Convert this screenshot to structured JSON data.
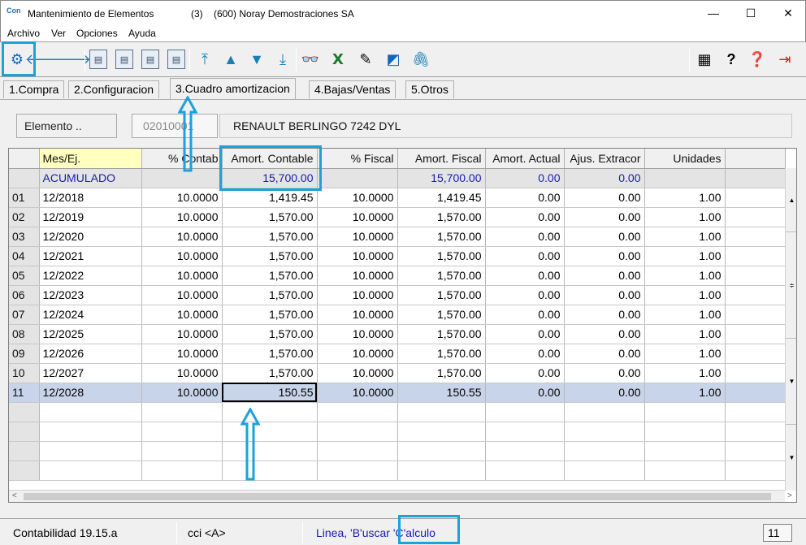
{
  "window": {
    "app_icon": "Con",
    "title": "Mantenimiento de Elementos",
    "count": "(3)",
    "company": "(600) Noray Demostraciones SA",
    "minimize": "—",
    "maximize": "☐",
    "close": "✕"
  },
  "menu": [
    {
      "label": "Archivo"
    },
    {
      "label": "Ver"
    },
    {
      "label": "Opciones"
    },
    {
      "label": "Ayuda"
    }
  ],
  "toolbar": {
    "icons": [
      "gear-icon",
      "arrow-left-icon",
      "arrow-right-icon",
      "doc-icon",
      "doc-icon",
      "doc-icon",
      "doc-icon",
      "first-icon",
      "up-icon",
      "down-icon",
      "last-icon",
      "binoculars-icon",
      "excel-icon",
      "tag-icon",
      "chart-icon",
      "paperclip-icon",
      "calculator-icon",
      "help-pointer-icon",
      "help-book-icon",
      "exit-icon"
    ],
    "excel_label": "X",
    "help_label": "?"
  },
  "tabs": [
    {
      "label": "1.Compra"
    },
    {
      "label": "2.Configuracion"
    },
    {
      "label": "3.Cuadro amortizacion"
    },
    {
      "label": "4.Bajas/Ventas"
    },
    {
      "label": "5.Otros"
    }
  ],
  "element": {
    "label": "Elemento ..",
    "code": "02010001",
    "description": "RENAULT BERLINGO 7242 DYL"
  },
  "grid": {
    "columns": [
      "",
      "Mes/Ej.",
      "% Contab",
      "Amort. Contable",
      "% Fiscal",
      "Amort. Fiscal",
      "Amort. Actual",
      "Ajus. Extracor",
      "Unidades",
      ""
    ],
    "acumulado": {
      "label": "ACUMULADO",
      "amort_contable": "15,700.00",
      "amort_fiscal": "15,700.00",
      "amort_actual": "0.00",
      "ajus": "0.00"
    },
    "rows": [
      {
        "n": "01",
        "mes": "12/2018",
        "pc": "10.0000",
        "ac": "1,419.45",
        "pf": "10.0000",
        "af": "1,419.45",
        "aa": "0.00",
        "ae": "0.00",
        "u": "1.00"
      },
      {
        "n": "02",
        "mes": "12/2019",
        "pc": "10.0000",
        "ac": "1,570.00",
        "pf": "10.0000",
        "af": "1,570.00",
        "aa": "0.00",
        "ae": "0.00",
        "u": "1.00"
      },
      {
        "n": "03",
        "mes": "12/2020",
        "pc": "10.0000",
        "ac": "1,570.00",
        "pf": "10.0000",
        "af": "1,570.00",
        "aa": "0.00",
        "ae": "0.00",
        "u": "1.00"
      },
      {
        "n": "04",
        "mes": "12/2021",
        "pc": "10.0000",
        "ac": "1,570.00",
        "pf": "10.0000",
        "af": "1,570.00",
        "aa": "0.00",
        "ae": "0.00",
        "u": "1.00"
      },
      {
        "n": "05",
        "mes": "12/2022",
        "pc": "10.0000",
        "ac": "1,570.00",
        "pf": "10.0000",
        "af": "1,570.00",
        "aa": "0.00",
        "ae": "0.00",
        "u": "1.00"
      },
      {
        "n": "06",
        "mes": "12/2023",
        "pc": "10.0000",
        "ac": "1,570.00",
        "pf": "10.0000",
        "af": "1,570.00",
        "aa": "0.00",
        "ae": "0.00",
        "u": "1.00"
      },
      {
        "n": "07",
        "mes": "12/2024",
        "pc": "10.0000",
        "ac": "1,570.00",
        "pf": "10.0000",
        "af": "1,570.00",
        "aa": "0.00",
        "ae": "0.00",
        "u": "1.00"
      },
      {
        "n": "08",
        "mes": "12/2025",
        "pc": "10.0000",
        "ac": "1,570.00",
        "pf": "10.0000",
        "af": "1,570.00",
        "aa": "0.00",
        "ae": "0.00",
        "u": "1.00"
      },
      {
        "n": "09",
        "mes": "12/2026",
        "pc": "10.0000",
        "ac": "1,570.00",
        "pf": "10.0000",
        "af": "1,570.00",
        "aa": "0.00",
        "ae": "0.00",
        "u": "1.00"
      },
      {
        "n": "10",
        "mes": "12/2027",
        "pc": "10.0000",
        "ac": "1,570.00",
        "pf": "10.0000",
        "af": "1,570.00",
        "aa": "0.00",
        "ae": "0.00",
        "u": "1.00"
      },
      {
        "n": "11",
        "mes": "12/2028",
        "pc": "10.0000",
        "ac": "150.55",
        "pf": "10.0000",
        "af": "150.55",
        "aa": "0.00",
        "ae": "0.00",
        "u": "1.00"
      }
    ],
    "scroll_arrows": {
      "up": "▲",
      "down": "▼",
      "left": "<",
      "right": ">",
      "mid": "≑"
    }
  },
  "status": {
    "app": "Contabilidad 19.15.a",
    "user": "cci <A>",
    "hint": "Linea, 'B'uscar 'C'alculo",
    "row_count": "11"
  },
  "colors": {
    "highlight": "#1ba1dc",
    "selected_row": "#c8d4ea",
    "accum_text": "#1a1ab0",
    "header_yellow": "#ffffc0"
  }
}
